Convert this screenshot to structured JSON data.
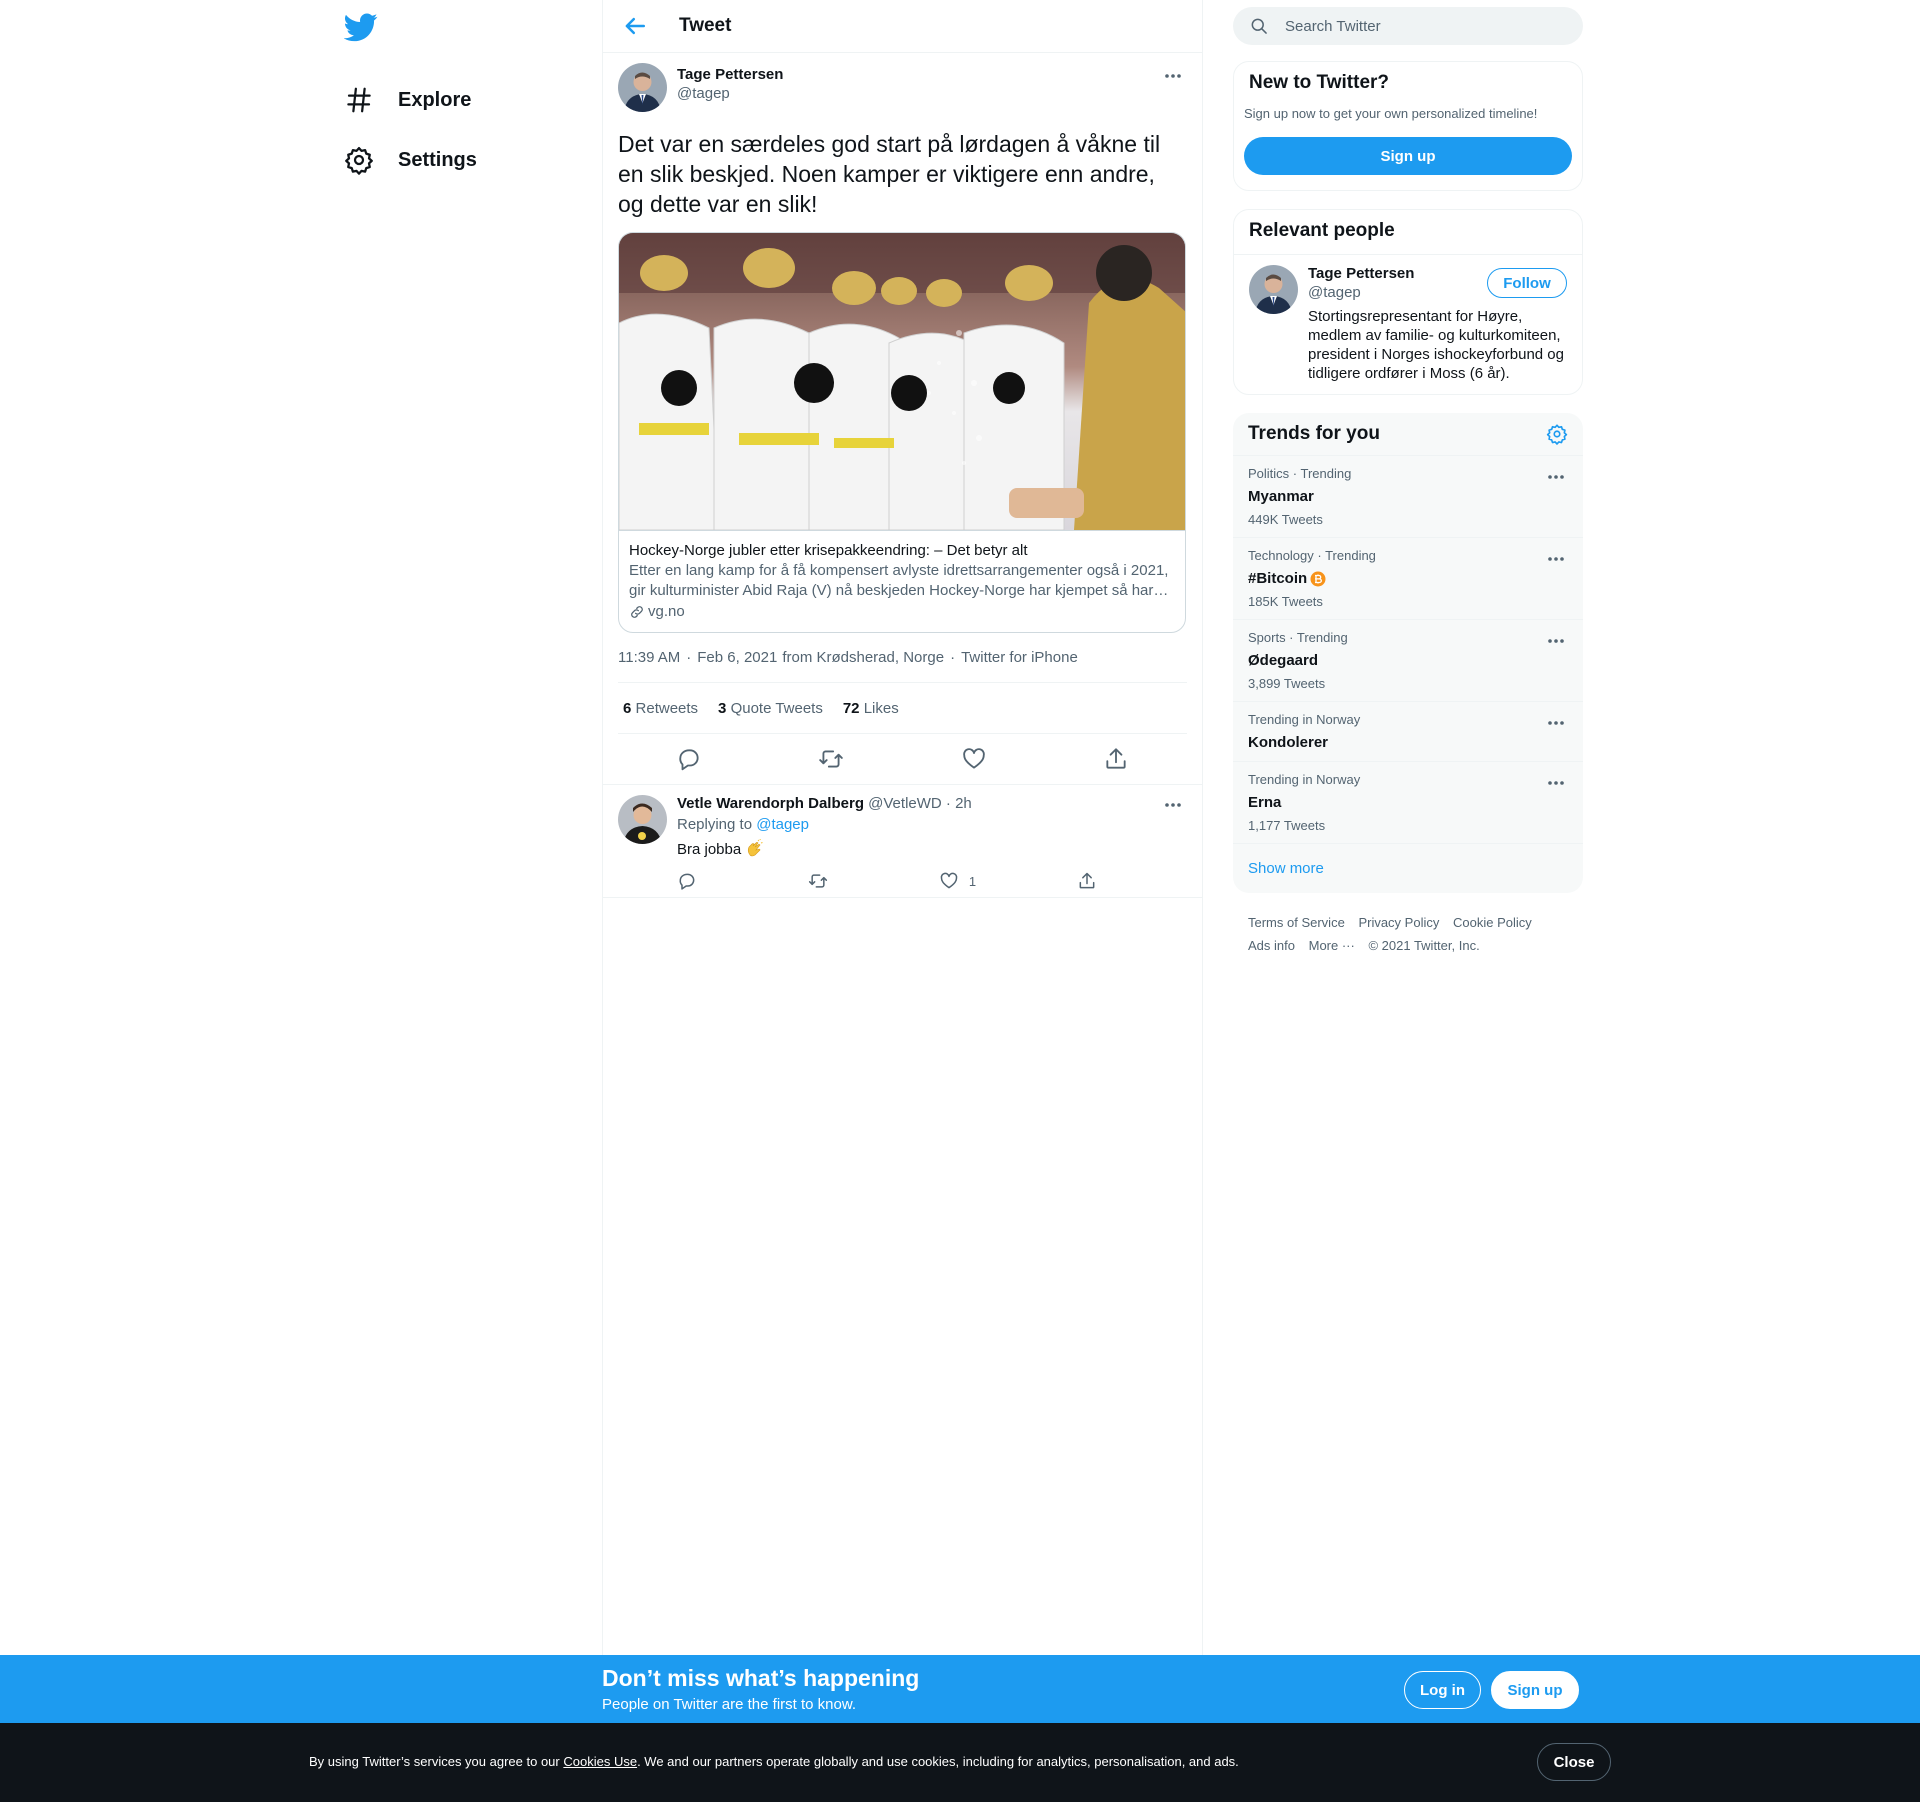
{
  "nav": {
    "items": [
      {
        "label": "Explore",
        "icon": "hashtag-icon"
      },
      {
        "label": "Settings",
        "icon": "gear-icon"
      }
    ]
  },
  "header": {
    "title": "Tweet"
  },
  "tweet": {
    "author_name": "Tage Pettersen",
    "author_handle": "@tagep",
    "text": "Det var en særdeles god start på lørdagen å våkne til en slik beskjed. Noen kamper er viktigere enn andre, og dette var en slik!",
    "card": {
      "title": "Hockey-Norge jubler etter krisepakkeendring: – Det betyr alt",
      "description": "Etter en lang kamp for å få kompensert avlyste idrettsarrangementer også i 2021, gir kulturminister Abid Raja (V) nå beskjeden Hockey-Norge har kjempet så har…",
      "domain": "vg.no"
    },
    "time": "11:39 AM",
    "date": "Feb 6, 2021",
    "location": "from Krødsherad, Norge",
    "source": "Twitter for iPhone",
    "sep": "·",
    "stats": {
      "retweets": "6",
      "retweets_label": "Retweets",
      "quotes": "3",
      "quotes_label": "Quote Tweets",
      "likes": "72",
      "likes_label": "Likes"
    }
  },
  "reply": {
    "name": "Vetle Warendorph Dalberg",
    "handle": "@VetleWD",
    "time": "· 2h",
    "replying_label": "Replying to",
    "replying_handle": "@tagep",
    "text": "Bra jobba",
    "like_count": "1"
  },
  "search": {
    "placeholder": "Search Twitter"
  },
  "signup_panel": {
    "title": "New to Twitter?",
    "subtitle": "Sign up now to get your own personalized timeline!",
    "button": "Sign up"
  },
  "people_panel": {
    "title": "Relevant people",
    "name": "Tage Pettersen",
    "handle": "@tagep",
    "bio": "Stortingsrepresentant for Høyre, medlem av familie- og kulturkomiteen, president i Norges ishockeyforbund og tidligere ordfører i Moss (6 år).",
    "follow": "Follow"
  },
  "trends": {
    "title": "Trends for you",
    "items": [
      {
        "context": "Politics · Trending",
        "name": "Myanmar",
        "count": "449K Tweets"
      },
      {
        "context": "Technology · Trending",
        "name": "#Bitcoin",
        "count": "185K Tweets"
      },
      {
        "context": "Sports · Trending",
        "name": "Ødegaard",
        "count": "3,899 Tweets"
      },
      {
        "context": "Trending in Norway",
        "name": "Kondolerer",
        "count": ""
      },
      {
        "context": "Trending in Norway",
        "name": "Erna",
        "count": "1,177 Tweets"
      }
    ],
    "show_more": "Show more"
  },
  "footer": {
    "links": [
      "Terms of Service",
      "Privacy Policy",
      "Cookie Policy",
      "Ads info",
      "More ···",
      "© 2021 Twitter, Inc."
    ]
  },
  "banner": {
    "title": "Don’t miss what’s happening",
    "subtitle": "People on Twitter are the first to know.",
    "login": "Log in",
    "signup": "Sign up"
  },
  "cookie": {
    "before": "By using Twitter’s services you agree to our ",
    "link": "Cookies Use",
    "after": ". We and our partners operate globally and use cookies, including for analytics, personalisation, and ads.",
    "close": "Close"
  },
  "colors": {
    "accent": "#1d9bf0",
    "text": "#0f1419",
    "muted": "#536471",
    "border": "#eff3f4"
  }
}
